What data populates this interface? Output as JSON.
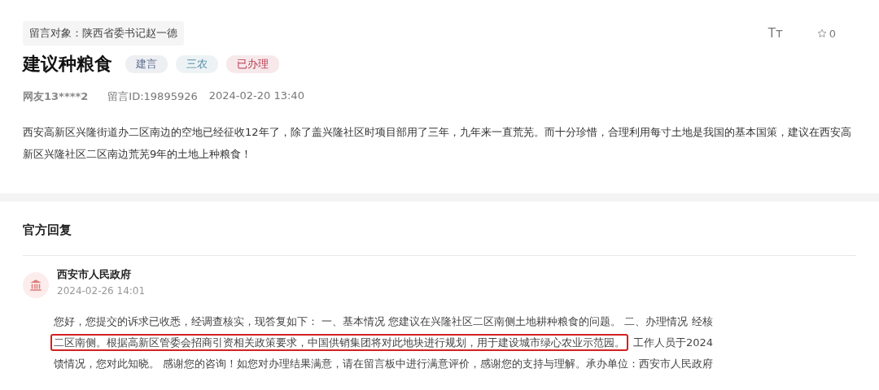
{
  "message": {
    "recipient": "留言对象：陕西省委书记赵一德",
    "title": "建议种粮食",
    "tags": [
      {
        "label": "建言",
        "color": "#5b6b8c"
      },
      {
        "label": "三农",
        "color": "#5a8fa8"
      },
      {
        "label": "已办理",
        "color": "#b8394c"
      }
    ],
    "font_toggle": "Tт",
    "favorites": "0",
    "author": "网友13****2",
    "message_id": "留言ID:19895926",
    "date": "2024-02-20 13:40",
    "body": "西安高新区兴隆街道办二区南边的空地已经征收12年了，除了盖兴隆社区时项目部用了三年，九年来一直荒芜。而十分珍惜，合理利用每寸土地是我国的基本国策，建议在西安高新区兴隆社区二区南边荒芜9年的土地上种粮食！"
  },
  "official_reply": {
    "heading": "官方回复",
    "agency": "西安市人民政府",
    "date": "2024-02-26 14:01",
    "lines": [
      [
        {
          "text": "您好，您提交的诉求已收悉，经调查核实，现答复如下： 一、基本情况 您建议在兴隆社区二区南侧土地耕种粮食的问题。 二、办理情况 经核",
          "highlighted": false
        }
      ],
      [
        {
          "text": "二区南侧。根据高新区管委会招商引资相关政策要求，中国供销集团将对此地块进行规划，用于建设城市绿心农业示范园。",
          "highlighted": true
        },
        {
          "text": "工作人员于2024",
          "highlighted": false
        }
      ],
      [
        {
          "text": "馈情况，您对此知晓。 感谢您的咨询！如您对办理结果满意，请在留言板中进行满意评价，感谢您的支持与理解。承办单位：西安市人民政府",
          "highlighted": false
        }
      ]
    ]
  }
}
